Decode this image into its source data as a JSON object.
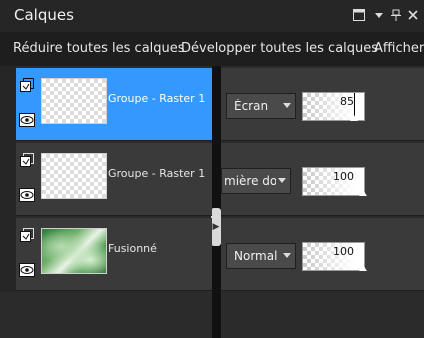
{
  "panel": {
    "title": "Calques"
  },
  "toolbar": {
    "collapse_all": "Réduire toutes les calques",
    "expand_all": "Développer toutes les calques",
    "show": "Afficher/"
  },
  "layers": [
    {
      "name": "Groupe - Raster 1",
      "blend_mode": "Écran",
      "opacity": "85",
      "opacity_fraction": 0.85,
      "selected": true,
      "type": "group",
      "thumbnail": "transparent",
      "visible_icon": "eye-icon"
    },
    {
      "name": "Groupe - Raster 1",
      "blend_mode": "mière dou",
      "opacity": "100",
      "opacity_fraction": 1.0,
      "selected": false,
      "type": "group",
      "thumbnail": "transparent",
      "visible_icon": "eye-icon"
    },
    {
      "name": "Fusionné",
      "blend_mode": "Normal",
      "opacity": "100",
      "opacity_fraction": 1.0,
      "selected": false,
      "type": "group",
      "thumbnail": "green-image",
      "visible_icon": "eye-icon"
    }
  ],
  "colors": {
    "selection": "#3399ff",
    "row": "#3a3a3a",
    "background": "#1a1a1a"
  },
  "icons": [
    "dock-icon",
    "menu-arrow-icon",
    "pin-icon",
    "close-icon",
    "group-layer-icon",
    "eye-icon",
    "splitter-handle-icon"
  ]
}
